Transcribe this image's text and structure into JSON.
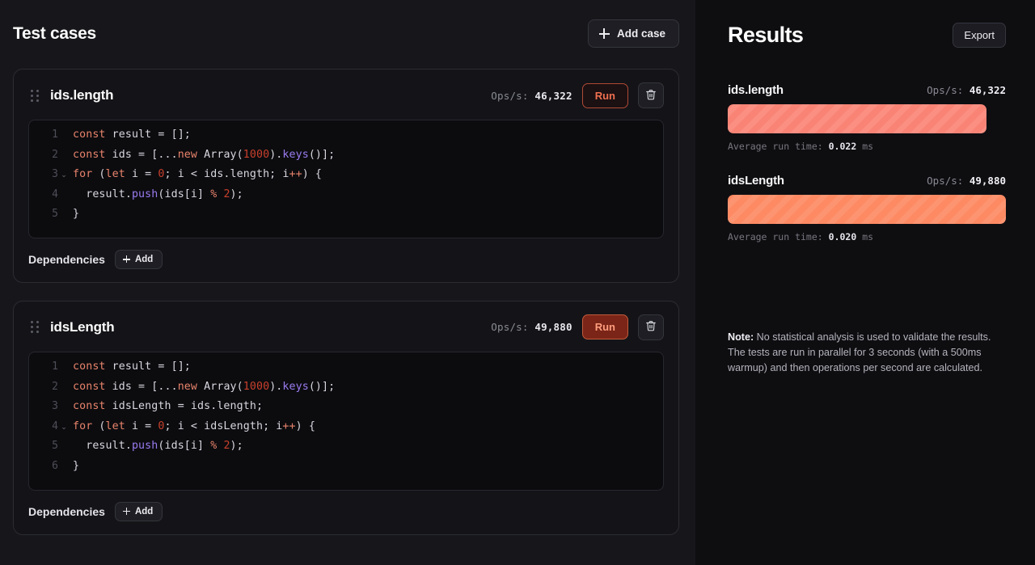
{
  "left": {
    "title": "Test cases",
    "add_case_label": "Add case",
    "cases": [
      {
        "name": "ids.length",
        "ops_label": "Ops/s:",
        "ops_value": "46,322",
        "run_label": "Run",
        "run_state": "idle",
        "deps_label": "Dependencies",
        "add_dep_label": "Add",
        "code": [
          {
            "n": "1",
            "fold": "",
            "tokens": [
              {
                "t": "const ",
                "c": "t-kw"
              },
              {
                "t": "result = [];",
                "c": "t-pl"
              }
            ]
          },
          {
            "n": "2",
            "fold": "",
            "tokens": [
              {
                "t": "const ",
                "c": "t-kw"
              },
              {
                "t": "ids = [...",
                "c": "t-pl"
              },
              {
                "t": "new ",
                "c": "t-kw"
              },
              {
                "t": "Array(",
                "c": "t-pl"
              },
              {
                "t": "1000",
                "c": "t-num"
              },
              {
                "t": ").",
                "c": "t-pl"
              },
              {
                "t": "keys",
                "c": "t-fn"
              },
              {
                "t": "()];",
                "c": "t-pl"
              }
            ]
          },
          {
            "n": "3",
            "fold": "⌄",
            "tokens": [
              {
                "t": "for ",
                "c": "t-kw"
              },
              {
                "t": "(",
                "c": "t-pl"
              },
              {
                "t": "let ",
                "c": "t-kw"
              },
              {
                "t": "i = ",
                "c": "t-pl"
              },
              {
                "t": "0",
                "c": "t-num"
              },
              {
                "t": "; i < ids.length; i",
                "c": "t-pl"
              },
              {
                "t": "++",
                "c": "t-kw"
              },
              {
                "t": ") {",
                "c": "t-pl"
              }
            ]
          },
          {
            "n": "4",
            "fold": "",
            "tokens": [
              {
                "t": "  result.",
                "c": "t-pl"
              },
              {
                "t": "push",
                "c": "t-fn"
              },
              {
                "t": "(ids[i] ",
                "c": "t-pl"
              },
              {
                "t": "% ",
                "c": "t-kw"
              },
              {
                "t": "2",
                "c": "t-num"
              },
              {
                "t": ");",
                "c": "t-pl"
              }
            ]
          },
          {
            "n": "5",
            "fold": "",
            "tokens": [
              {
                "t": "}",
                "c": "t-pl"
              }
            ]
          }
        ]
      },
      {
        "name": "idsLength",
        "ops_label": "Ops/s:",
        "ops_value": "49,880",
        "run_label": "Run",
        "run_state": "active",
        "deps_label": "Dependencies",
        "add_dep_label": "Add",
        "code": [
          {
            "n": "1",
            "fold": "",
            "tokens": [
              {
                "t": "const ",
                "c": "t-kw"
              },
              {
                "t": "result = [];",
                "c": "t-pl"
              }
            ]
          },
          {
            "n": "2",
            "fold": "",
            "tokens": [
              {
                "t": "const ",
                "c": "t-kw"
              },
              {
                "t": "ids = [...",
                "c": "t-pl"
              },
              {
                "t": "new ",
                "c": "t-kw"
              },
              {
                "t": "Array(",
                "c": "t-pl"
              },
              {
                "t": "1000",
                "c": "t-num"
              },
              {
                "t": ").",
                "c": "t-pl"
              },
              {
                "t": "keys",
                "c": "t-fn"
              },
              {
                "t": "()];",
                "c": "t-pl"
              }
            ]
          },
          {
            "n": "3",
            "fold": "",
            "tokens": [
              {
                "t": "const ",
                "c": "t-kw"
              },
              {
                "t": "idsLength = ids.length;",
                "c": "t-pl"
              }
            ]
          },
          {
            "n": "4",
            "fold": "⌄",
            "tokens": [
              {
                "t": "for ",
                "c": "t-kw"
              },
              {
                "t": "(",
                "c": "t-pl"
              },
              {
                "t": "let ",
                "c": "t-kw"
              },
              {
                "t": "i = ",
                "c": "t-pl"
              },
              {
                "t": "0",
                "c": "t-num"
              },
              {
                "t": "; i < idsLength; i",
                "c": "t-pl"
              },
              {
                "t": "++",
                "c": "t-kw"
              },
              {
                "t": ") {",
                "c": "t-pl"
              }
            ]
          },
          {
            "n": "5",
            "fold": "",
            "tokens": [
              {
                "t": "  result.",
                "c": "t-pl"
              },
              {
                "t": "push",
                "c": "t-fn"
              },
              {
                "t": "(ids[i] ",
                "c": "t-pl"
              },
              {
                "t": "% ",
                "c": "t-kw"
              },
              {
                "t": "2",
                "c": "t-num"
              },
              {
                "t": ");",
                "c": "t-pl"
              }
            ]
          },
          {
            "n": "6",
            "fold": "",
            "tokens": [
              {
                "t": "}",
                "c": "t-pl"
              }
            ]
          }
        ]
      }
    ]
  },
  "right": {
    "title": "Results",
    "export_label": "Export",
    "note_prefix": "Note:",
    "note_text": " No statistical analysis is used to validate the results. The tests are run in parallel for 3 seconds (with a 500ms warmup) and then operations per second are calculated.",
    "results": [
      {
        "name": "ids.length",
        "ops_label": "Ops/s:",
        "ops_value": "46,322",
        "bar_pct": 92.9,
        "bar_color": "#f98476",
        "avg_prefix": "Average run time:",
        "avg_value": "0.022",
        "avg_unit": "ms"
      },
      {
        "name": "idsLength",
        "ops_label": "Ops/s:",
        "ops_value": "49,880",
        "bar_pct": 100,
        "bar_color": "#fd8a63",
        "avg_prefix": "Average run time:",
        "avg_value": "0.020",
        "avg_unit": "ms"
      }
    ]
  },
  "chart_data": {
    "type": "bar",
    "title": "Results",
    "categories": [
      "ids.length",
      "idsLength"
    ],
    "values": [
      46322,
      49880
    ],
    "ylabel": "Ops/s",
    "xlabel": "",
    "ylim": [
      0,
      49880
    ],
    "annotations": [
      "Average run time: 0.022 ms",
      "Average run time: 0.020 ms"
    ],
    "orientation": "horizontal",
    "grid": false,
    "legend": "none"
  }
}
